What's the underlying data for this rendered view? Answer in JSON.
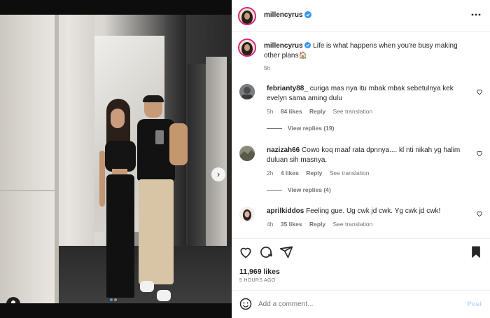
{
  "post": {
    "username": "millencyrus",
    "caption_text": "Life is what happens when you're busy making other plans",
    "caption_emoji": "🏠",
    "caption_time": "5h",
    "likes_count": "11,969 likes",
    "time_ago": "5 HOURS AGO",
    "more_icon": "more-horizontal-icon",
    "carousel": {
      "slides": 2,
      "active": 1
    }
  },
  "comments": [
    {
      "username": "febrianty88_",
      "text": "curiga mas nya itu mbak mbak sebetulnya kek evelyn sama aming dulu",
      "time": "5h",
      "likes": "84 likes",
      "reply_label": "Reply",
      "translate_label": "See translation",
      "view_replies": "View replies (19)"
    },
    {
      "username": "nazizah66",
      "text": "Cowo koq maaf rata dpnnya.... kl nti nikah yg halim duluan sih masnya.",
      "time": "2h",
      "likes": "4 likes",
      "reply_label": "Reply",
      "translate_label": "See translation",
      "view_replies": "View replies (4)"
    },
    {
      "username": "aprilkiddos",
      "text": "Feeling gue. Ug cwk jd cwk. Yg cwk jd cwk!",
      "time": "4h",
      "likes": "35 likes",
      "reply_label": "Reply",
      "translate_label": "See translation"
    }
  ],
  "composer": {
    "placeholder": "Add a comment...",
    "post_label": "Post"
  },
  "colors": {
    "accent_blue": "#0095f6",
    "verified": "#3897f0",
    "text": "#262626",
    "muted": "#737373"
  }
}
